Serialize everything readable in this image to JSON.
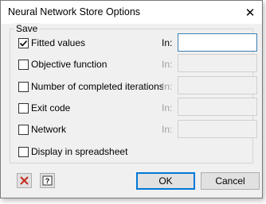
{
  "window": {
    "title": "Neural Network Store Options",
    "close_symbol": "✕"
  },
  "group": {
    "label": "Save"
  },
  "options": [
    {
      "label": "Fitted values",
      "checked": true,
      "in_label": "In:",
      "in_value": "",
      "in_enabled": true
    },
    {
      "label": "Objective function",
      "checked": false,
      "in_label": "In:",
      "in_value": "",
      "in_enabled": false
    },
    {
      "label": "Number of completed iterations",
      "checked": false,
      "in_label": "In:",
      "in_value": "",
      "in_enabled": false
    },
    {
      "label": "Exit code",
      "checked": false,
      "in_label": "In:",
      "in_value": "",
      "in_enabled": false
    },
    {
      "label": "Network",
      "checked": false,
      "in_label": "In:",
      "in_value": "",
      "in_enabled": false
    }
  ],
  "spreadsheet": {
    "label": "Display in spreadsheet",
    "checked": false
  },
  "footer": {
    "clear_icon": "red-x-icon",
    "help_icon": "help-question-icon",
    "ok_label": "OK",
    "cancel_label": "Cancel"
  },
  "colors": {
    "clear_icon": "#c42b1c",
    "focus_border": "#0078d7",
    "active_field_border": "#3c7fb1"
  }
}
